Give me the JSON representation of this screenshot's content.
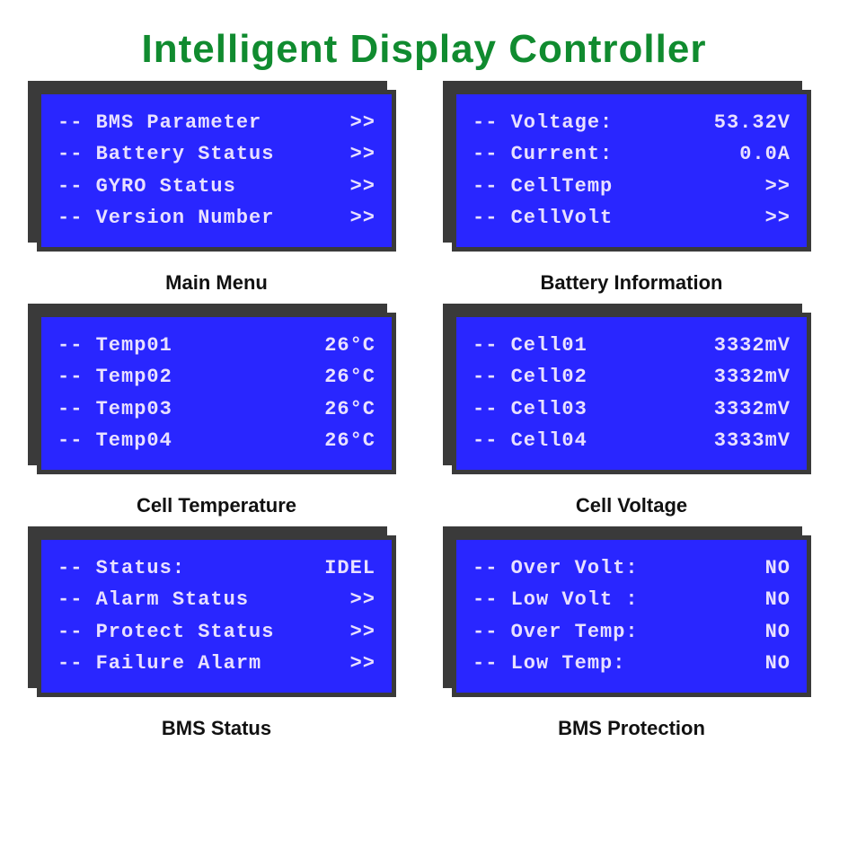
{
  "title": "Intelligent Display Controller",
  "screens": [
    {
      "caption": "Main Menu",
      "rows": [
        {
          "label": "-- BMS Parameter",
          "value": ">>"
        },
        {
          "label": "-- Battery Status",
          "value": ">>"
        },
        {
          "label": "-- GYRO Status",
          "value": ">>"
        },
        {
          "label": "-- Version Number",
          "value": ">>"
        }
      ]
    },
    {
      "caption": "Battery Information",
      "rows": [
        {
          "label": "-- Voltage:",
          "value": "53.32V"
        },
        {
          "label": "-- Current:",
          "value": "0.0A"
        },
        {
          "label": "-- CellTemp",
          "value": ">>"
        },
        {
          "label": "-- CellVolt",
          "value": ">>"
        }
      ]
    },
    {
      "caption": "Cell Temperature",
      "rows": [
        {
          "label": "-- Temp01",
          "value": "26°C"
        },
        {
          "label": "-- Temp02",
          "value": "26°C"
        },
        {
          "label": "-- Temp03",
          "value": "26°C"
        },
        {
          "label": "-- Temp04",
          "value": "26°C"
        }
      ]
    },
    {
      "caption": "Cell Voltage",
      "rows": [
        {
          "label": "-- Cell01",
          "value": "3332mV"
        },
        {
          "label": "-- Cell02",
          "value": "3332mV"
        },
        {
          "label": "-- Cell03",
          "value": "3332mV"
        },
        {
          "label": "-- Cell04",
          "value": "3333mV"
        }
      ]
    },
    {
      "caption": "BMS Status",
      "rows": [
        {
          "label": "-- Status:",
          "value": "IDEL"
        },
        {
          "label": "-- Alarm Status",
          "value": ">>"
        },
        {
          "label": "-- Protect Status",
          "value": ">>"
        },
        {
          "label": "-- Failure Alarm",
          "value": ">>"
        }
      ]
    },
    {
      "caption": "BMS Protection",
      "rows": [
        {
          "label": "-- Over Volt:",
          "value": "NO"
        },
        {
          "label": "-- Low Volt :",
          "value": "NO"
        },
        {
          "label": "-- Over Temp:",
          "value": "NO"
        },
        {
          "label": "-- Low Temp:",
          "value": "NO"
        }
      ]
    }
  ]
}
